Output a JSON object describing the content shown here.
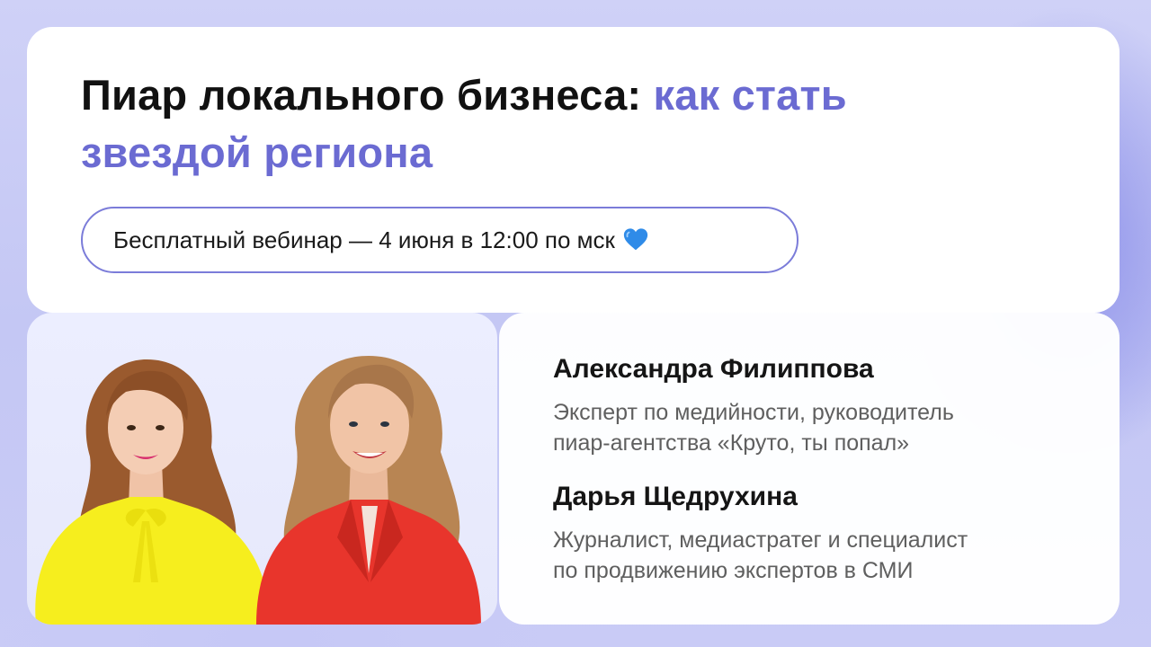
{
  "headline": {
    "part1": "Пиар локального бизнеса: ",
    "part2": "как стать",
    "part3": "звездой региона"
  },
  "webinar": {
    "text": "Бесплатный вебинар — 4 июня в 12:00 по мск",
    "heart_icon": "blue-heart-icon"
  },
  "speakers": [
    {
      "name": "Александра Филиппова",
      "desc_line1": "Эксперт по медийности, руководитель",
      "desc_line2": "пиар-агентства «Круто, ты попал»"
    },
    {
      "name": "Дарья Щедрухина",
      "desc_line1": "Журналист, медиастратег и специалист",
      "desc_line2": "по продвижению экспертов в СМИ"
    }
  ],
  "colors": {
    "accent": "#6b6bd2",
    "pill_border": "#7b7cd9",
    "background": "#c6c8f5",
    "speaker1_blouse": "#f6ee1e",
    "speaker2_jacket": "#e8352c"
  }
}
